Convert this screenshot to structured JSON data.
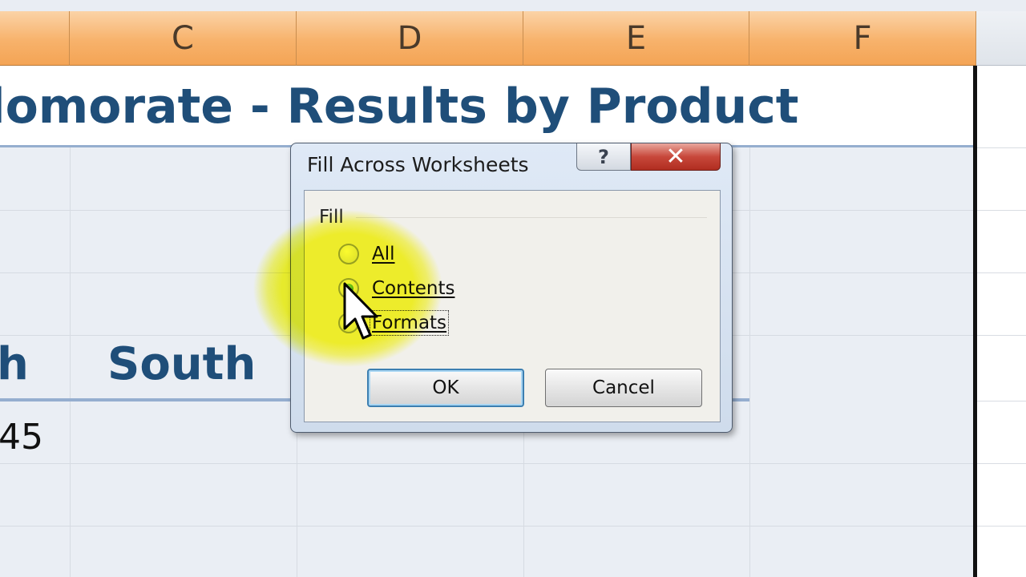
{
  "sheet": {
    "columns": [
      "C",
      "D",
      "E",
      "F"
    ],
    "title": "lomorate - Results by Product",
    "region_headers": {
      "col_b": "h",
      "col_c": "South"
    },
    "values": {
      "col_b": "45"
    }
  },
  "dialog": {
    "title": "Fill Across Worksheets",
    "help_label": "?",
    "close_label": "✕",
    "group_label": "Fill",
    "options": [
      {
        "label": "All",
        "checked": false
      },
      {
        "label": "Contents",
        "checked": true
      },
      {
        "label": "Formats",
        "checked": false
      }
    ],
    "ok_label": "OK",
    "cancel_label": "Cancel"
  },
  "colors": {
    "column_header": "#f7b26b",
    "title_text": "#1f4e79",
    "highlight": "#fafa00"
  },
  "icons": [
    "help-icon",
    "close-icon",
    "mouse-pointer-icon"
  ]
}
